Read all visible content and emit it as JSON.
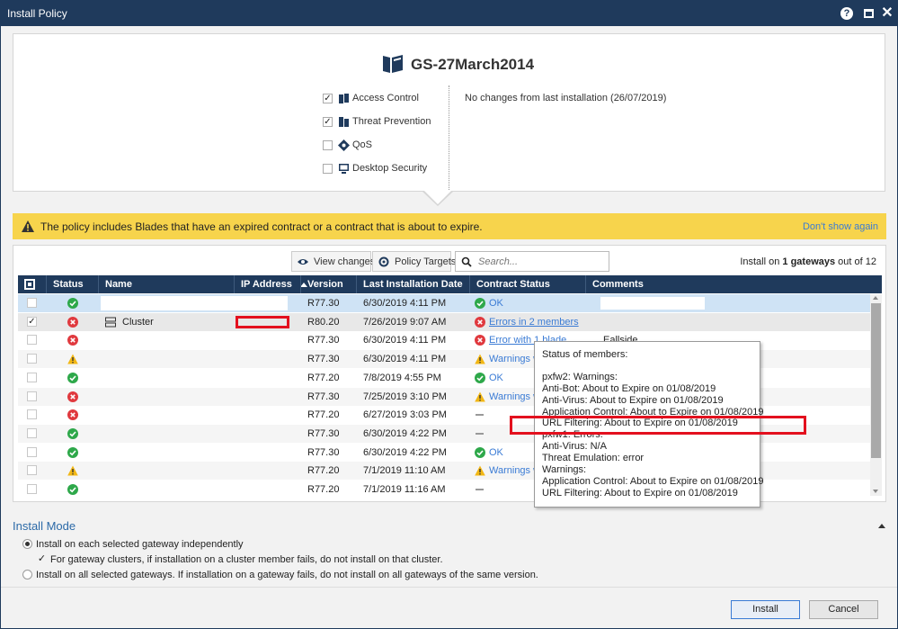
{
  "window": {
    "title": "Install Policy"
  },
  "policy": {
    "name": "GS-27March2014",
    "blades": [
      {
        "label": "Access Control",
        "checked": true,
        "icon": "access-control-icon"
      },
      {
        "label": "Threat Prevention",
        "checked": true,
        "icon": "threat-prevention-icon"
      },
      {
        "label": "QoS",
        "checked": false,
        "icon": "qos-icon"
      },
      {
        "label": "Desktop Security",
        "checked": false,
        "icon": "desktop-security-icon"
      }
    ],
    "changes_text": "No changes from last installation (26/07/2019)"
  },
  "warning": {
    "text": "The policy includes Blades that have an expired contract or a contract that is about to expire.",
    "dismiss_label": "Don't show again",
    "color": "#f7d44c"
  },
  "toolbar": {
    "view_changes": "View changes",
    "policy_targets": "Policy Targets",
    "search_placeholder": "Search...",
    "install_on_prefix": "Install on",
    "install_on_count": "1 gateways",
    "install_on_suffix": "out of 12"
  },
  "table": {
    "columns": [
      "Status",
      "Name",
      "IP Address",
      "Version",
      "Last Installation Date",
      "Contract Status",
      "Comments"
    ],
    "rows": [
      {
        "checked": false,
        "status": "ok",
        "name": "",
        "version": "R77.30",
        "date": "6/30/2019 4:11 PM",
        "contract_icon": "ok",
        "contract": "OK",
        "comment": ""
      },
      {
        "checked": true,
        "status": "error",
        "name": "Cluster",
        "version": "R80.20",
        "date": "7/26/2019 9:07 AM",
        "contract_icon": "error",
        "contract": "Errors in 2 members",
        "comment": ""
      },
      {
        "checked": false,
        "status": "error",
        "name": "",
        "version": "R77.30",
        "date": "6/30/2019 4:11 PM",
        "contract_icon": "error",
        "contract": "Error with 1 blade",
        "comment": "Eallside"
      },
      {
        "checked": false,
        "status": "warning",
        "name": "",
        "version": "R77.30",
        "date": "6/30/2019 4:11 PM",
        "contract_icon": "warning",
        "contract": "Warnings w",
        "comment": ""
      },
      {
        "checked": false,
        "status": "ok",
        "name": "",
        "version": "R77.20",
        "date": "7/8/2019 4:55 PM",
        "contract_icon": "ok",
        "contract": "OK",
        "comment": ""
      },
      {
        "checked": false,
        "status": "error",
        "name": "",
        "version": "R77.30",
        "date": "7/25/2019 3:10 PM",
        "contract_icon": "warning",
        "contract": "Warnings w",
        "comment": ""
      },
      {
        "checked": false,
        "status": "error",
        "name": "",
        "version": "R77.20",
        "date": "6/27/2019 3:03 PM",
        "contract_icon": "none",
        "contract": "",
        "comment": ""
      },
      {
        "checked": false,
        "status": "ok",
        "name": "",
        "version": "R77.30",
        "date": "6/30/2019 4:22 PM",
        "contract_icon": "none",
        "contract": "",
        "comment": ""
      },
      {
        "checked": false,
        "status": "ok",
        "name": "",
        "version": "R77.30",
        "date": "6/30/2019 4:22 PM",
        "contract_icon": "ok",
        "contract": "OK",
        "comment": ""
      },
      {
        "checked": false,
        "status": "warning",
        "name": "",
        "version": "R77.20",
        "date": "7/1/2019 11:10 AM",
        "contract_icon": "warning",
        "contract": "Warnings w",
        "comment": ""
      },
      {
        "checked": false,
        "status": "ok",
        "name": "",
        "version": "R77.20",
        "date": "7/1/2019 11:16 AM",
        "contract_icon": "none",
        "contract": "",
        "comment": ""
      }
    ]
  },
  "tooltip": {
    "heading": "Status of members:",
    "lines": [
      "pxfw2: Warnings:",
      "Anti-Bot: About to Expire on 01/08/2019",
      "Anti-Virus: About to Expire on 01/08/2019",
      "Application Control: About to Expire on 01/08/2019",
      "URL Filtering: About to Expire on 01/08/2019",
      "pxfw1: Errors:",
      "Anti-Virus: N/A",
      "Threat Emulation: error",
      "Warnings:",
      "Application Control: About to Expire on 01/08/2019",
      "URL Filtering: About to Expire on 01/08/2019"
    ]
  },
  "install_mode": {
    "title": "Install Mode",
    "option1": "Install on each selected gateway independently",
    "option1_sub": "For gateway clusters, if installation on a cluster member fails, do not install on that cluster.",
    "option2": "Install on all selected gateways. If installation on a gateway fails, do not install on all gateways of the same version."
  },
  "footer": {
    "install": "Install",
    "cancel": "Cancel"
  },
  "colors": {
    "titlebar": "#1f3a5c",
    "ok": "#2ea84a",
    "error": "#e0393e",
    "warning": "#f2b714",
    "link": "#3a7bd5",
    "highlight": "#e3101e"
  }
}
